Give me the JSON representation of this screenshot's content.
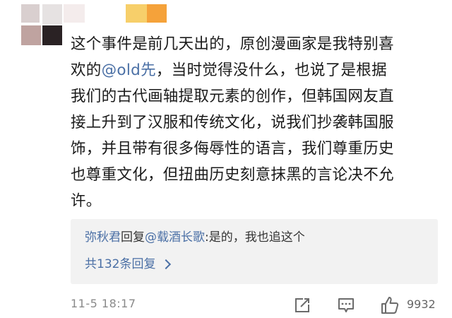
{
  "comment": {
    "line1": "这个事件是前几天出的，原创漫画家是我特别喜",
    "line2_pre": "欢的",
    "line2_mention": "@old先",
    "line2_post": "，当时觉得没什么，也说了是根据",
    "line3": "我们的古代画轴提取元素的创作，但韩国网友直",
    "line4": "接上升到了汉服和传统文化，说我们抄袭韩国服",
    "line5": "饰，并且带有很多侮辱性的语言，我们尊重历史",
    "line6": "也尊重文化，但扭曲历史刻意抹黑的言论决不允",
    "line7": "许。"
  },
  "reply": {
    "user": "弥秋君",
    "verb": "回复",
    "target": "@载酒长歌",
    "content": ":是的，我也追这个",
    "count_label": "共132条回复"
  },
  "footer": {
    "timestamp": "11-5 18:17",
    "like_count": "9932",
    "icons": [
      "share-icon",
      "comment-icon",
      "like-icon"
    ]
  },
  "colors": {
    "link": "#4a6fa5",
    "reply_bg": "#f2f2f2",
    "meta": "#8a8a8a"
  }
}
